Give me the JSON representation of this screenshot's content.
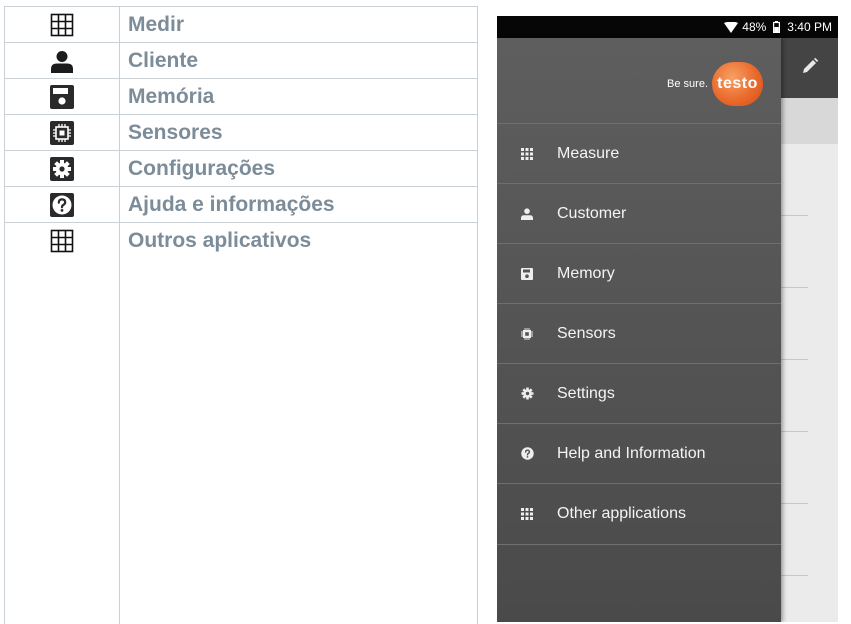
{
  "legend": {
    "rows": [
      {
        "icon": "grid-icon",
        "label": "Medir"
      },
      {
        "icon": "person-icon",
        "label": "Cliente"
      },
      {
        "icon": "save-icon",
        "label": "Memória"
      },
      {
        "icon": "chip-icon",
        "label": "Sensores"
      },
      {
        "icon": "gear-icon",
        "label": "Configurações"
      },
      {
        "icon": "help-icon",
        "label": "Ajuda e informações"
      },
      {
        "icon": "grid-icon",
        "label": "Outros aplicativos"
      }
    ]
  },
  "phone": {
    "status_bar": {
      "battery": "48%",
      "time": "3:40 PM"
    },
    "brand": {
      "tagline": "Be sure.",
      "logo": "testo"
    },
    "drawer_items": [
      {
        "icon": "grid-icon",
        "label": "Measure"
      },
      {
        "icon": "person-icon",
        "label": "Customer"
      },
      {
        "icon": "save-icon",
        "label": "Memory"
      },
      {
        "icon": "chip-icon",
        "label": "Sensors"
      },
      {
        "icon": "gear-icon",
        "label": "Settings"
      },
      {
        "icon": "help-icon",
        "label": "Help and Information"
      },
      {
        "icon": "grid-icon",
        "label": "Other applications"
      }
    ]
  },
  "colors": {
    "legend_text": "#7c8c98",
    "drawer_bg": "#565656",
    "brand_orange": "#ea6a2c"
  }
}
